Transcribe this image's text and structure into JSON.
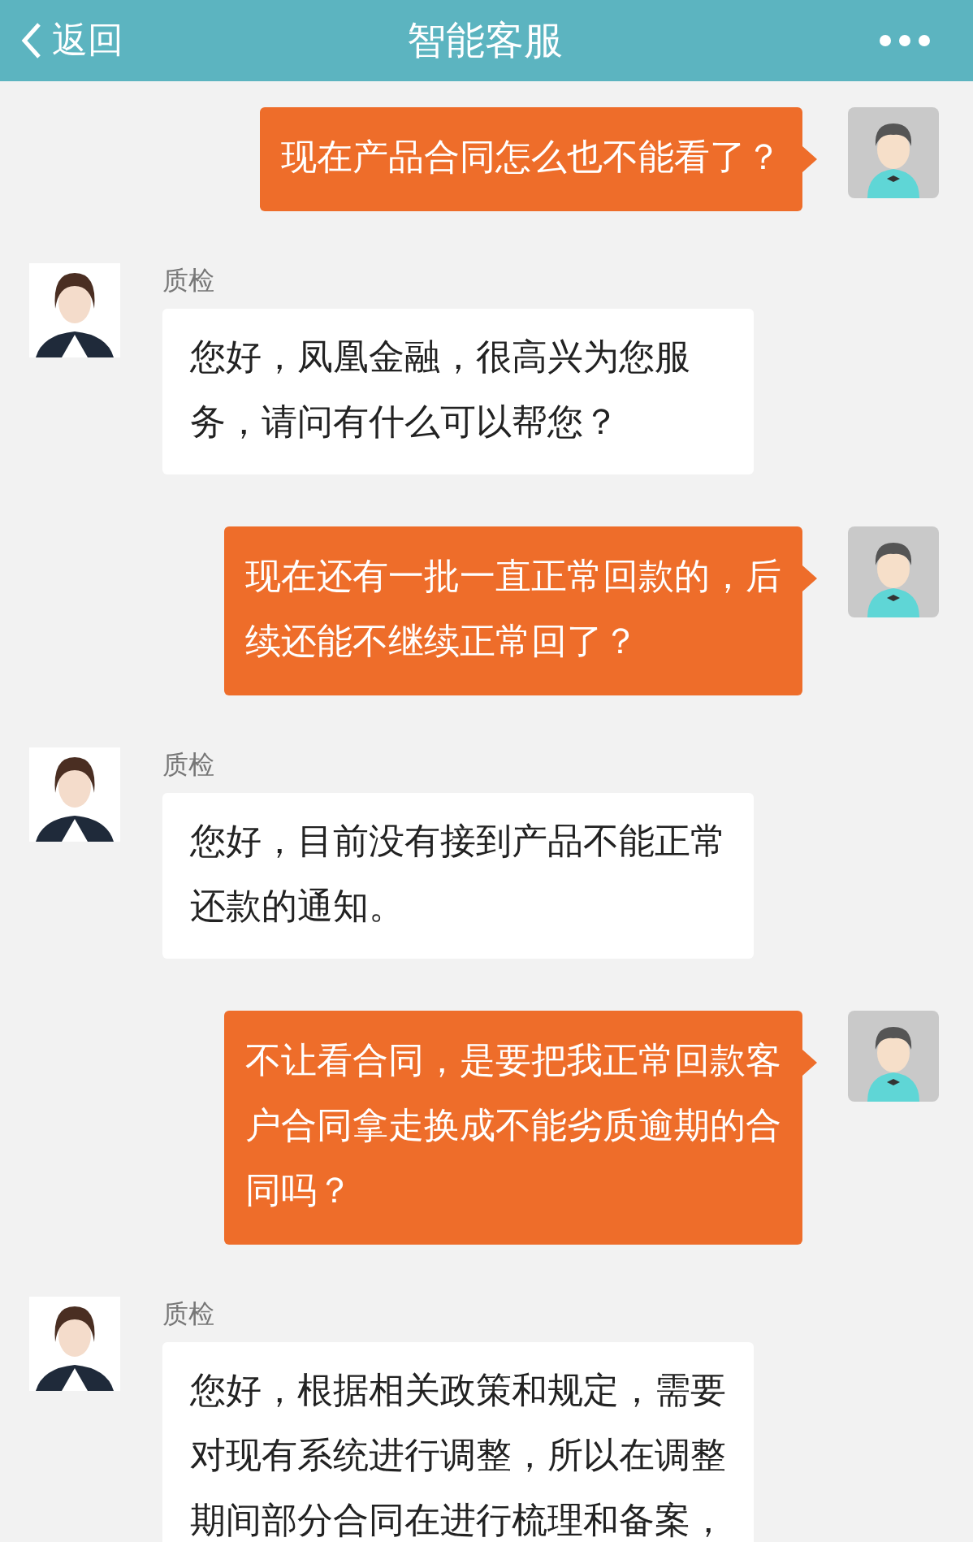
{
  "header": {
    "back_label": "返回",
    "title": "智能客服"
  },
  "messages": [
    {
      "kind": "sent",
      "text": "现在产品合同怎么也不能看了？"
    },
    {
      "kind": "received",
      "sender": "质检",
      "text": "您好，凤凰金融，很高兴为您服务，请问有什么可以帮您？"
    },
    {
      "kind": "sent",
      "text": "现在还有一批一直正常回款的，后续还能不继续正常回了？"
    },
    {
      "kind": "received",
      "sender": "质检",
      "text": "您好，目前没有接到产品不能正常还款的通知。"
    },
    {
      "kind": "sent",
      "text": "不让看合同，是要把我正常回款客户合同拿走换成不能劣质逾期的合同吗？"
    },
    {
      "kind": "received",
      "sender": "质检",
      "text": "您好，根据相关政策和规定，需要对现有系统进行调整，所以在调整期间部分合同在进行梳理和备案，"
    }
  ]
}
